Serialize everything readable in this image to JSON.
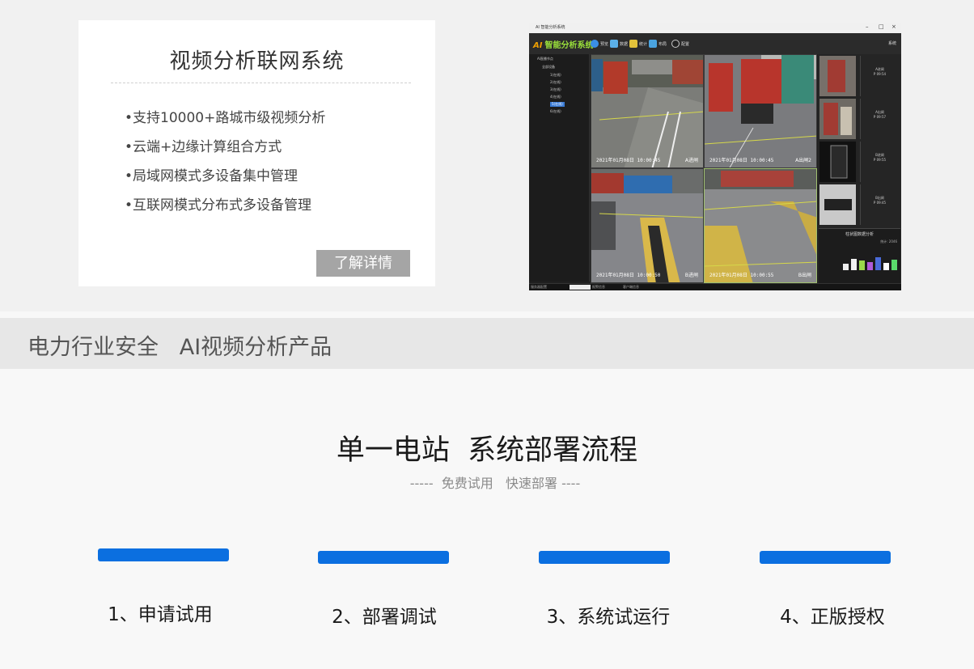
{
  "intro_card": {
    "title": "视频分析联网系统",
    "features": [
      "•支持10000+路城市级视频分析",
      "•云端+边缘计算组合方式",
      "•局域网模式多设备集中管理",
      "•互联网模式分布式多设备管理"
    ],
    "more_button": "了解详情"
  },
  "app_screenshot": {
    "window_title": "AI 智能分析系统",
    "brand_prefix": "AI",
    "brand": "智能分析系统",
    "toolbar": [
      "预览",
      "数据",
      "统计",
      "布局",
      "配置"
    ],
    "exit_label": "系统",
    "tree": [
      "AI直播节点",
      "全部设备",
      "1(在线)",
      "2(在线)",
      "3(在线)",
      "4(在线)",
      "5(在线)",
      "6(在线)"
    ],
    "timestamps": [
      "2021年01月08日  10:00:45",
      "2021年01月08日  10:00:45",
      "2021年01月08日  10:00:50",
      "2021年01月08日  10:00:55"
    ],
    "camera_labels": [
      "A进闸",
      "A出闸2",
      "B进闸",
      "B出闸"
    ],
    "thumb_info": [
      "A进闸\nP 09:54",
      "A出闸\nP 09:57",
      "B进闸\nP 09:55",
      "B出闸\nP 09:45"
    ],
    "chart_title": "柱状图数据分析",
    "chart_stat": "统计: 2046",
    "status_texts": [
      "服务器配置",
      "报警信息",
      "客户端信息"
    ]
  },
  "band": {
    "text": "电力行业安全   AI视频分析产品"
  },
  "flow": {
    "title": "单一电站  系统部署流程",
    "subtitle": "-----  免费试用   快速部署 ----",
    "steps": [
      "1、申请试用",
      "2、部署调试",
      "3、系统试运行",
      "4、正版授权"
    ]
  },
  "colors": {
    "accent": "#0b6fe0",
    "button_gray": "#a5a5a5",
    "band_bg": "#e7e7e7"
  }
}
